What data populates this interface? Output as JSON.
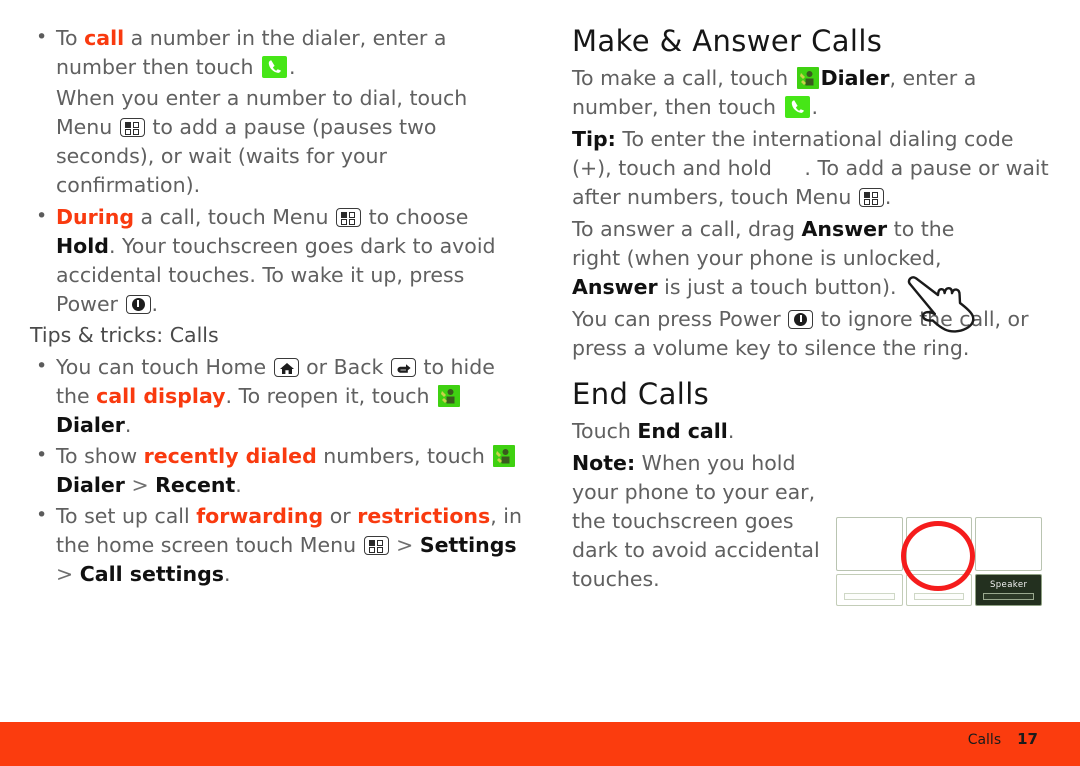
{
  "colors": {
    "accent_orange": "#f93a0f",
    "footer_bar": "#fb3c0e",
    "app_icon_green": "#3fd111",
    "call_button_green": "#46e617",
    "highlight_circle_red": "#f51c1c",
    "body_text": "#606060",
    "heading_text": "#161616"
  },
  "left_column": {
    "bullet1": {
      "pre": "To ",
      "hl": "call",
      "mid": " a number in the dialer, enter a number then touch ",
      "icon": "green-call-button-icon",
      "post": "."
    },
    "bullet1_sub": "When you enter a number to dial, touch Menu ",
    "bullet1_sub_icon": "menu-icon",
    "bullet1_sub_rest": " to add a pause (pauses two seconds), or wait (waits for your confirmation).",
    "bullet2": {
      "hl": "During",
      "mid": " a call, touch Menu ",
      "icon1": "menu-icon",
      "mid2": " to choose ",
      "bold": "Hold",
      "mid3": ". Your touchscreen goes dark to avoid accidental touches. To wake it up, press Power ",
      "icon2": "power-icon",
      "post": "."
    },
    "subhead": "Tips & tricks: Calls",
    "bullet3": {
      "pre": "You can touch Home ",
      "icon1": "home-icon",
      "mid": " or Back ",
      "icon2": "back-icon",
      "mid2": " to hide the ",
      "hl": "call display",
      "mid3": ". To reopen it, touch ",
      "icon3": "dialer-app-icon",
      "bold": "Dialer",
      "post": "."
    },
    "bullet4": {
      "pre": "To show ",
      "hl": "recently dialed",
      "mid": " numbers, touch ",
      "icon": "dialer-app-icon",
      "bold1": "Dialer",
      "sep": " > ",
      "bold2": "Recent",
      "post": "."
    },
    "bullet5": {
      "pre": "To set up call ",
      "hl1": "forwarding",
      "mid": " or ",
      "hl2": "restrictions",
      "mid2": ", in the home screen touch Menu ",
      "icon": "menu-icon",
      "sep1": " > ",
      "bold1": "Settings",
      "sep2": " > ",
      "bold2": "Call settings",
      "post": "."
    }
  },
  "right_column": {
    "heading1": "Make & Answer Calls",
    "para1": {
      "pre": "To make a call, touch ",
      "icon1": "dialer-app-icon",
      "bold": "Dialer",
      "mid": ", enter a number, then touch ",
      "icon2": "green-call-button-icon",
      "post": "."
    },
    "tip": {
      "label": "Tip:",
      "text_a": " To enter the international dialing code (+), touch and hold ",
      "text_b": ". To add a pause or wait after numbers, touch Menu ",
      "icon": "menu-icon",
      "post": "."
    },
    "para_answer": {
      "pre": "To answer a call, drag ",
      "bold1": "Answer",
      "mid": " to the right (when your phone is unlocked, ",
      "bold2": "Answer",
      "post": " is just a touch button)."
    },
    "para_power": {
      "pre": "You can press Power ",
      "icon": "power-icon",
      "post": " to ignore the call, or press a volume key to silence the ring."
    },
    "heading2": "End Calls",
    "para_end": {
      "pre": "Touch ",
      "bold": "End call",
      "post": "."
    },
    "note": {
      "label": "Note:",
      "text": " When you hold your phone to your ear, the touchscreen goes dark to avoid accidental touches."
    },
    "illustration": {
      "hand_icon": "pointing-hand-icon",
      "speaker_key_label": "Speaker",
      "highlighted_key": "end-call-key"
    }
  },
  "footer": {
    "section": "Calls",
    "page_number": "17"
  }
}
